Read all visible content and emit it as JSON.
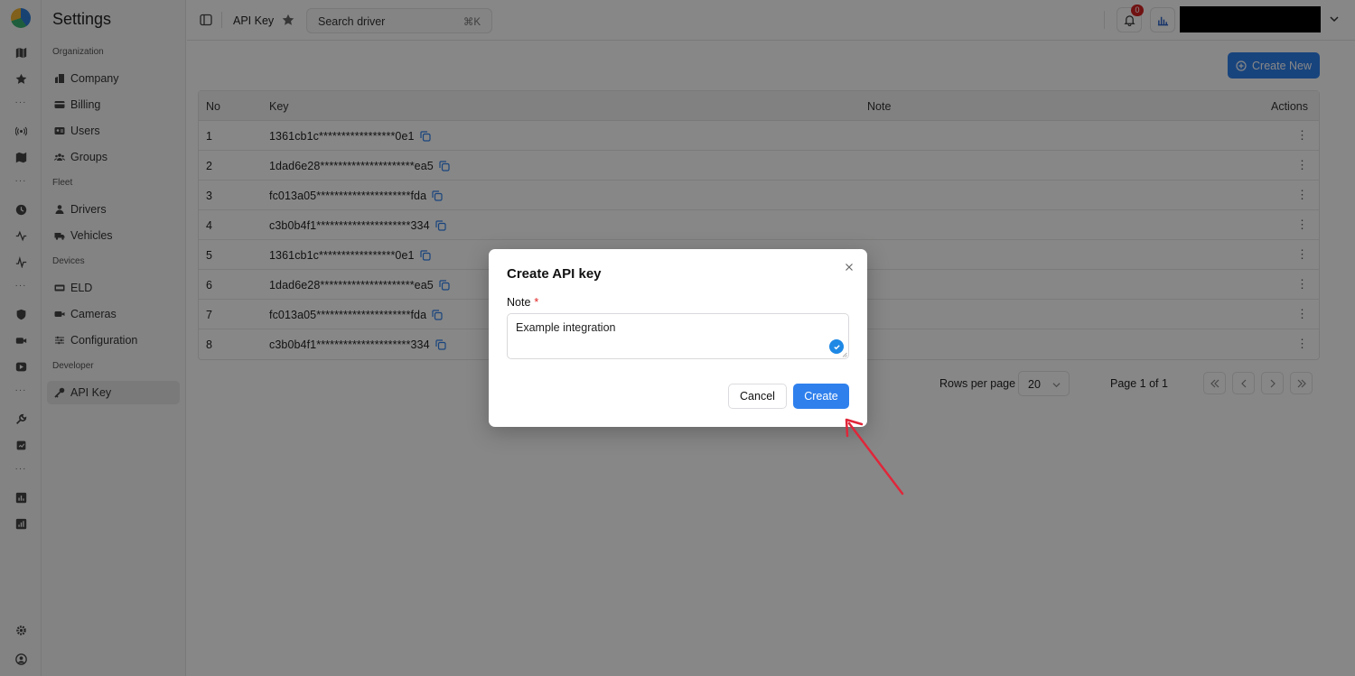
{
  "sidebar": {
    "title": "Settings",
    "groups": {
      "organization": "Organization",
      "fleet": "Fleet",
      "devices": "Devices",
      "developer": "Developer"
    },
    "items": {
      "company": "Company",
      "billing": "Billing",
      "users": "Users",
      "groups": "Groups",
      "drivers": "Drivers",
      "vehicles": "Vehicles",
      "eld": "ELD",
      "cameras": "Cameras",
      "configuration": "Configuration",
      "api_key": "API Key"
    }
  },
  "topbar": {
    "breadcrumb": "API Key",
    "search_placeholder": "Search driver",
    "search_shortcut": "⌘K",
    "notification_count": "0"
  },
  "main": {
    "create_new_label": "Create New",
    "columns": {
      "no": "No",
      "key": "Key",
      "note": "Note",
      "actions": "Actions"
    },
    "rows": [
      {
        "no": "1",
        "key": "1361cb1c*****************0e1"
      },
      {
        "no": "2",
        "key": "1dad6e28*********************ea5"
      },
      {
        "no": "3",
        "key": "fc013a05*********************fda"
      },
      {
        "no": "4",
        "key": "c3b0b4f1*********************334"
      },
      {
        "no": "5",
        "key": "1361cb1c*****************0e1"
      },
      {
        "no": "6",
        "key": "1dad6e28*********************ea5"
      },
      {
        "no": "7",
        "key": "fc013a05*********************fda"
      },
      {
        "no": "8",
        "key": "c3b0b4f1*********************334"
      }
    ],
    "actions_glyph": "⋮",
    "pagination": {
      "rows_per_page_label": "Rows per page",
      "rows_per_page_value": "20",
      "page_label": "Page 1 of 1"
    }
  },
  "modal": {
    "title": "Create API key",
    "note_label": "Note",
    "required_mark": "*",
    "note_value": "Example integration",
    "cancel_label": "Cancel",
    "create_label": "Create"
  },
  "colors": {
    "primary": "#2f80ed",
    "badge": "#d62222",
    "required": "#e02424",
    "annotation_arrow": "#e0263a"
  }
}
